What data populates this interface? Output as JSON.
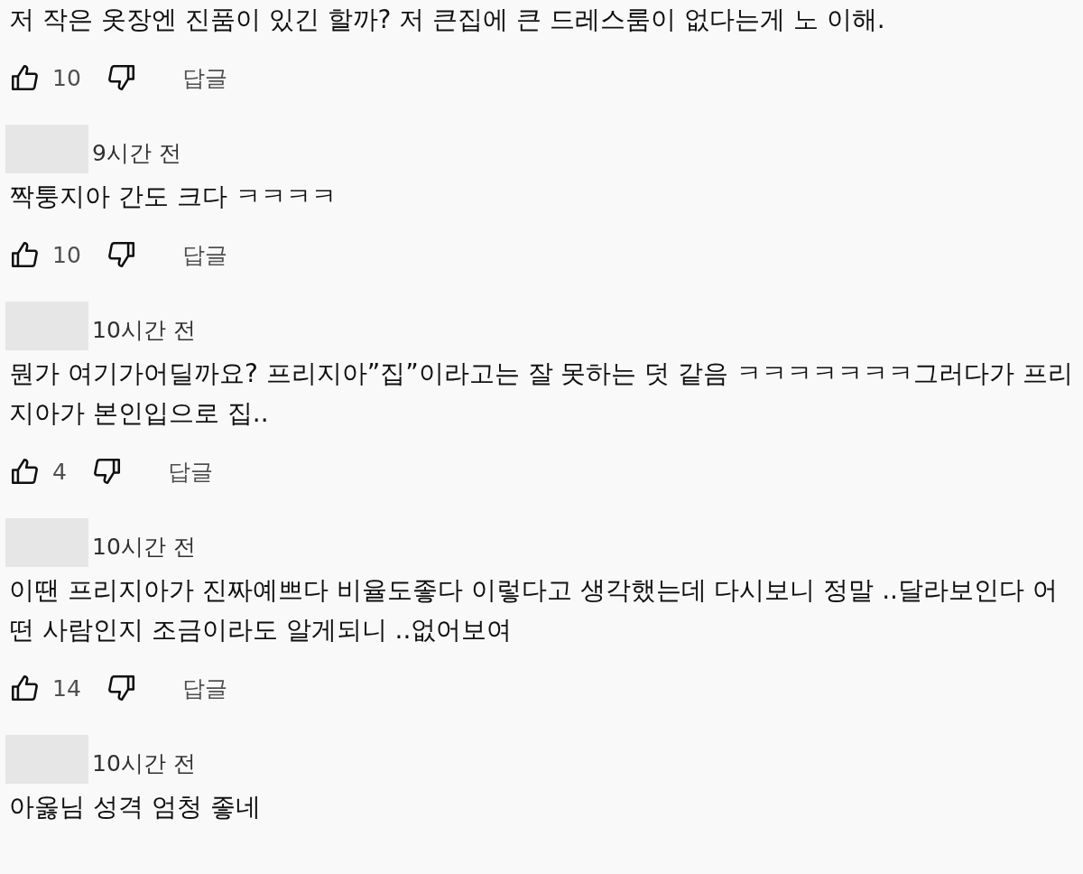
{
  "comments": [
    {
      "text": "저 작은 옷장엔 진품이 있긴 할까? 저 큰집에 큰 드레스룸이 없다는게 노 이해.",
      "likes": "10",
      "reply": "답글"
    },
    {
      "time": "9시간 전",
      "text": "짝퉁지아 간도 크다 ㅋㅋㅋㅋ",
      "likes": "10",
      "reply": "답글"
    },
    {
      "time": "10시간 전",
      "text": "뭔가 여기가어딜까요? 프리지아”집”이라고는 잘 못하는 덧 같음 ㅋㅋㅋㅋㅋㅋㅋ그러다가 프리지아가 본인입으로 집..",
      "likes": "4",
      "reply": "답글"
    },
    {
      "time": "10시간 전",
      "text": "이땐 프리지아가 진짜예쁘다 비율도좋다 이렇다고 생각했는데 다시보니 정말 ..달라보인다 어떤 사람인지 조금이라도 알게되니  ..없어보여",
      "likes": "14",
      "reply": "답글"
    },
    {
      "time": "10시간 전",
      "text": "아옳님 성격 엄청 좋네"
    }
  ]
}
